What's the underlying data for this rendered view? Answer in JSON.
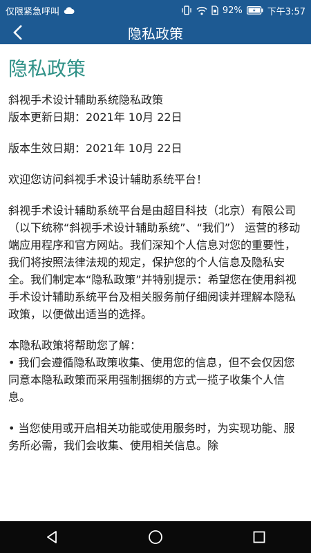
{
  "status_bar": {
    "carrier_text": "仅限紧急呼叫",
    "battery_text": "92%",
    "time": "下午3:57",
    "icons": [
      "cloud-icon",
      "vibrate-icon",
      "wifi-icon",
      "sim-icon",
      "battery-icon"
    ]
  },
  "header": {
    "title": "隐私政策",
    "back_glyph": "〈"
  },
  "content": {
    "heading": "隐私政策",
    "meta_line1": "斜视手术设计辅助系统隐私政策",
    "meta_line2": "版本更新日期：2021年 10月 22日",
    "effective_date": "版本生效日期：2021年 10月 22日",
    "welcome": "欢迎您访问斜视手术设计辅助系统平台！",
    "intro": "斜视手术设计辅助系统平台是由超目科技（北京）有限公司（以下统称“斜视手术设计辅助系统”、“我们”） 运营的移动端应用程序和官方网站。我们深知个人信息对您的重要性，我们将按照法律法规的规定，保护您的个人信息及隐私安全。我们制定本“隐私政策”并特别提示：希望您在使用斜视手术设计辅助系统平台及相关服务前仔细阅读并理解本隐私政策，以便做出适当的选择。",
    "summary_label": "本隐私政策将帮助您了解：",
    "bullet1": "• 我们会遵循隐私政策收集、使用您的信息，但不会仅因您同意本隐私政策而采用强制捆绑的方式一揽子收集个人信息。",
    "bullet2": "• 当您使用或开启相关功能或使用服务时，为实现功能、服务所必需，我们会收集、使用相关信息。除"
  },
  "colors": {
    "primary": "#1d5a93",
    "heading": "#2f9187",
    "text": "#222222",
    "nav_bg": "#0a0a0a"
  },
  "system_nav": {
    "icons": [
      "back-triangle-icon",
      "home-circle-icon",
      "recents-square-icon"
    ]
  }
}
